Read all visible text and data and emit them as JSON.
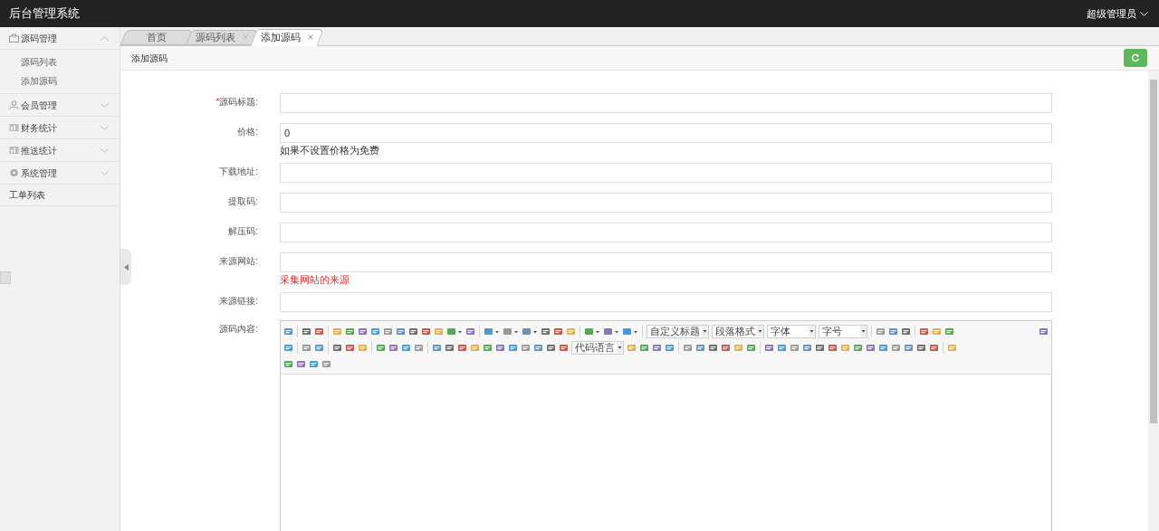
{
  "header": {
    "title": "后台管理系统",
    "user": "超级管理员"
  },
  "sidebar": {
    "items": [
      {
        "label": "源码管理",
        "kind": "group",
        "expanded": true,
        "children": [
          {
            "label": "源码列表"
          },
          {
            "label": "添加源码"
          }
        ]
      },
      {
        "label": "会员管理",
        "kind": "group",
        "expanded": false
      },
      {
        "label": "财务统计",
        "kind": "group",
        "expanded": false
      },
      {
        "label": "推送统计",
        "kind": "group",
        "expanded": false
      },
      {
        "label": "系统管理",
        "kind": "group",
        "expanded": false
      },
      {
        "label": "工单列表",
        "kind": "link"
      }
    ]
  },
  "tabs": [
    {
      "label": "首页",
      "selected": false,
      "closable": false
    },
    {
      "label": "源码列表",
      "selected": false,
      "closable": true
    },
    {
      "label": "添加源码",
      "selected": true,
      "closable": true
    }
  ],
  "breadcrumb": "添加源码",
  "form": {
    "fields": [
      {
        "label": "源码标题:",
        "required_mark": "*"
      },
      {
        "label": "价格:",
        "value": "0",
        "hint": {
          "text": "如果不设置价格为免费",
          "kind": "note"
        }
      },
      {
        "label": "下载地址:"
      },
      {
        "label": "提取码:"
      },
      {
        "label": "解压码:"
      },
      {
        "label": "来源网站:",
        "hint": {
          "text": "采集网站的来源",
          "kind": "error"
        }
      },
      {
        "label": "来源链接:"
      }
    ],
    "editor": {
      "label": "源码内容:",
      "dropdowns": [
        "自定义标题",
        "段落格式",
        "字体",
        "字号",
        "代码语言"
      ]
    }
  }
}
